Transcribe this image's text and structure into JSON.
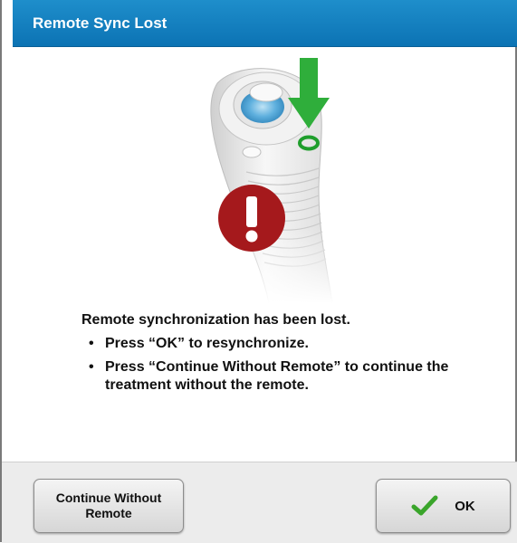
{
  "dialog": {
    "title": "Remote Sync Lost",
    "title_bar_color": "#0f7bbd",
    "alert_color": "#a5191c",
    "arrow_color": "#2fae3b"
  },
  "message": {
    "headline": "Remote synchronization has been lost.",
    "bullets": [
      "Press “OK” to resynchronize.",
      "Press “Continue Without Remote” to continue the treatment without the remote."
    ]
  },
  "icons": {
    "illustration": "remote-handpiece-illustration",
    "arrow": "down-arrow-icon",
    "alert": "exclamation-alert-icon",
    "check": "checkmark-icon"
  },
  "buttons": {
    "continue_label": "Continue Without Remote",
    "ok_label": "OK"
  }
}
